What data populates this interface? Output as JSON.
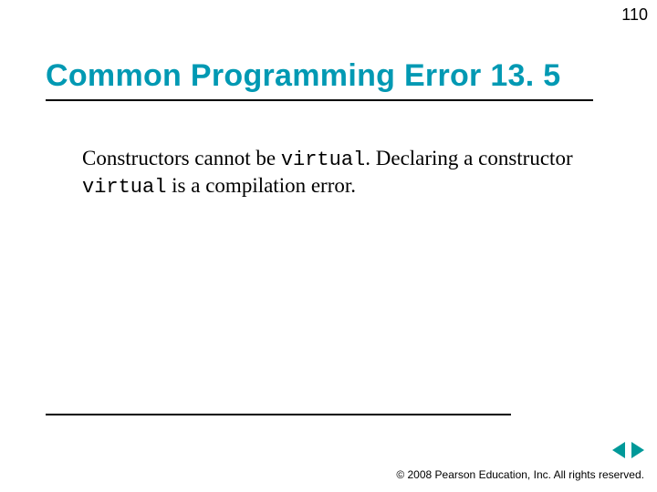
{
  "page_number": "110",
  "title": "Common Programming Error 13. 5",
  "body": {
    "t1": "Constructors cannot be ",
    "k1": "virtual",
    "t2": ". Declaring a constructor ",
    "k2": "virtual",
    "t3": " is a compilation error."
  },
  "footer": {
    "copyright": "© 2008 Pearson Education, Inc.  All rights reserved."
  },
  "colors": {
    "accent": "#0099b3",
    "nav": "#009999"
  }
}
